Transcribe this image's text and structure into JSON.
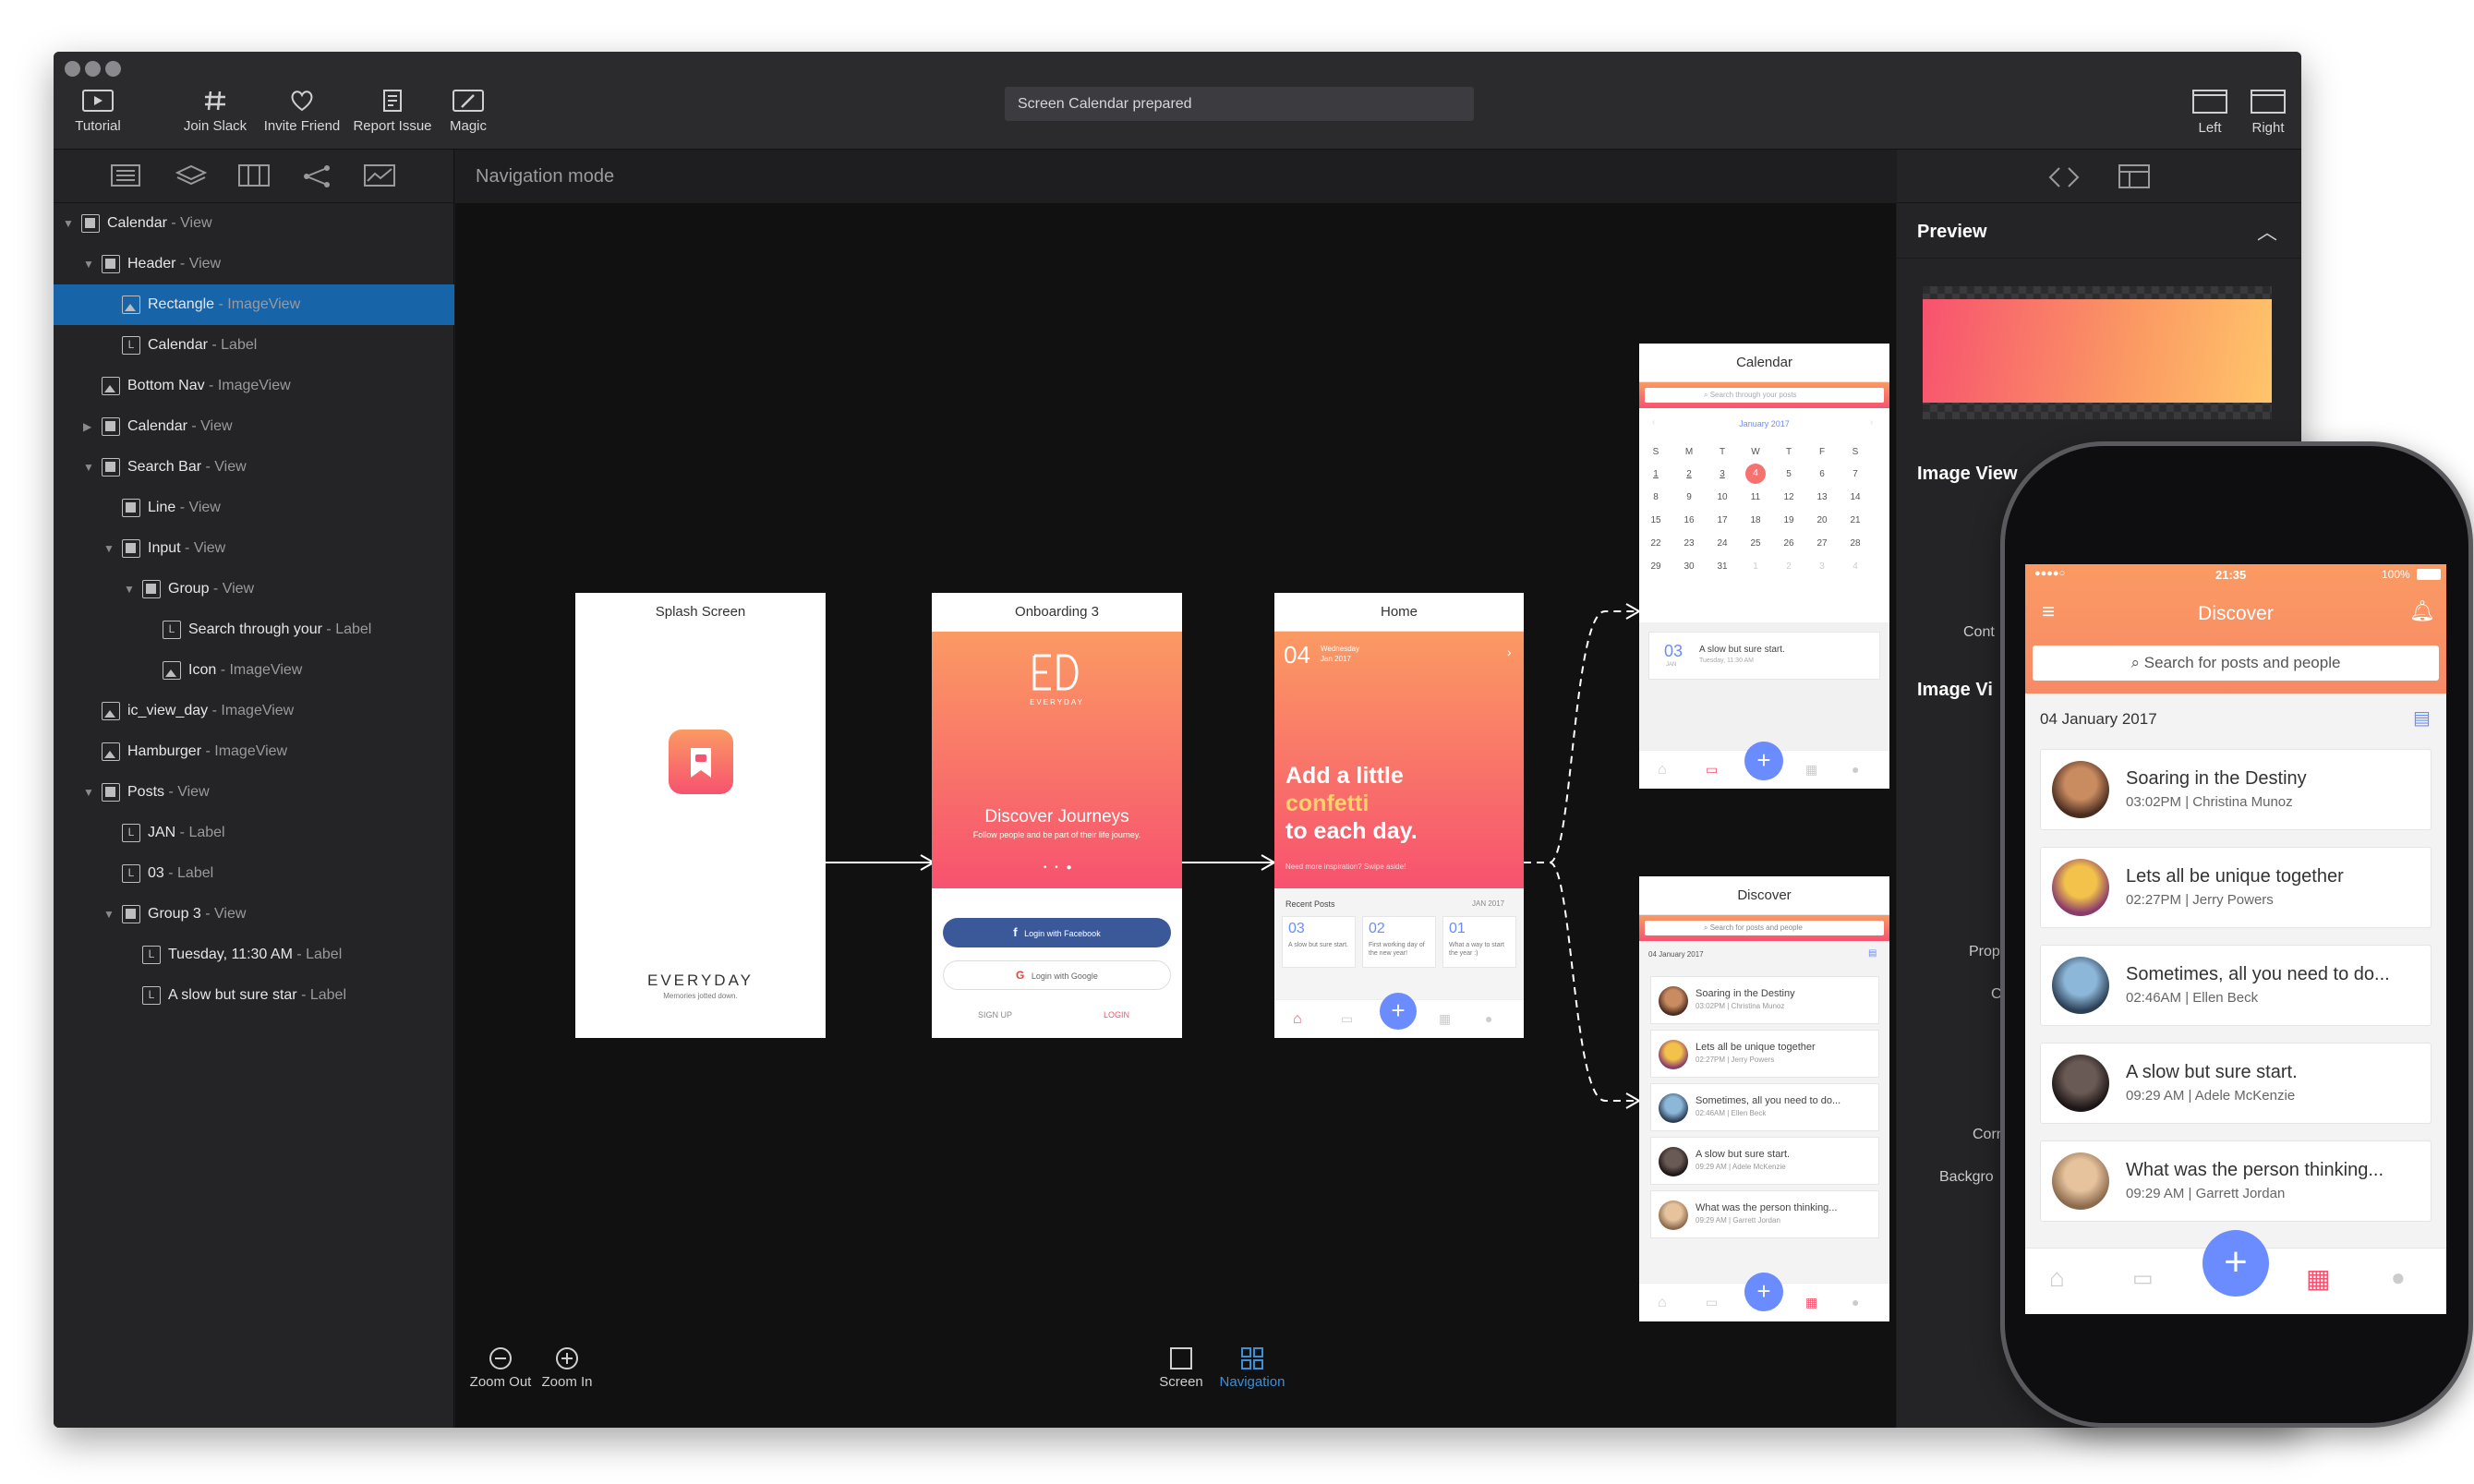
{
  "toolbar": {
    "tutorial": "Tutorial",
    "join_slack": "Join Slack",
    "invite_friend": "Invite Friend",
    "report_issue": "Report Issue",
    "magic": "Magic",
    "status": "Screen Calendar prepared",
    "left": "Left",
    "right": "Right"
  },
  "canvas": {
    "mode": "Navigation mode",
    "zoom_out": "Zoom Out",
    "zoom_in": "Zoom In",
    "screen": "Screen",
    "navigation": "Navigation"
  },
  "tree": [
    {
      "name": "Calendar",
      "kind": " - View"
    },
    {
      "name": "Header",
      "kind": " - View"
    },
    {
      "name": "Rectangle",
      "kind": " - ImageView"
    },
    {
      "name": "Calendar",
      "kind": " - Label"
    },
    {
      "name": "Bottom Nav",
      "kind": " - ImageView"
    },
    {
      "name": "Calendar",
      "kind": " - View"
    },
    {
      "name": "Search Bar",
      "kind": " - View"
    },
    {
      "name": "Line",
      "kind": " - View"
    },
    {
      "name": "Input",
      "kind": " - View"
    },
    {
      "name": "Group",
      "kind": " - View"
    },
    {
      "name": "Search through your",
      "kind": " - Label"
    },
    {
      "name": "Icon",
      "kind": " - ImageView"
    },
    {
      "name": "ic_view_day",
      "kind": " - ImageView"
    },
    {
      "name": "Hamburger",
      "kind": " - ImageView"
    },
    {
      "name": "Posts",
      "kind": " - View"
    },
    {
      "name": "JAN",
      "kind": " - Label"
    },
    {
      "name": "03",
      "kind": " - Label"
    },
    {
      "name": "Group 3",
      "kind": " - View"
    },
    {
      "name": "Tuesday, 11:30 AM",
      "kind": " - Label"
    },
    {
      "name": "A slow but sure star",
      "kind": " - Label"
    }
  ],
  "right_panel": {
    "preview": "Preview",
    "image_view": "Image View",
    "cont": "Cont",
    "image_vi": "Image Vi",
    "prope": "Prope",
    "cl": "Cl",
    "corn": "Corn",
    "backgro": "Backgro"
  },
  "splash": {
    "title": "Splash Screen",
    "brand": "EVERYDAY",
    "tagline": "Memories jotted down."
  },
  "onboarding": {
    "title": "Onboarding 3",
    "brand": "EVERYDAY",
    "heading": "Discover Journeys",
    "sub": "Follow people and be part of their life journey.",
    "facebook": "Login with Facebook",
    "google": "Login with Google",
    "signup": "SIGN UP",
    "login": "LOGIN"
  },
  "home": {
    "title": "Home",
    "day": "04",
    "weekday": "Wednesday",
    "month": "Jan 2017",
    "line1": "Add a little",
    "line2": "confetti",
    "line3": "to each day.",
    "sub": "Need more inspiration? Swipe aside!",
    "recent": "Recent Posts",
    "month_label": "JAN 2017",
    "cards": [
      {
        "day": "03",
        "text": "A slow but sure start."
      },
      {
        "day": "02",
        "text": "First working day of the new year!"
      },
      {
        "day": "01",
        "text": "What a way to start the year :)"
      }
    ]
  },
  "calendar": {
    "title": "Calendar",
    "search": "Search through your posts",
    "month": "January 2017",
    "weekdays": [
      "S",
      "M",
      "T",
      "W",
      "T",
      "F",
      "S"
    ],
    "days": [
      "1",
      "2",
      "3",
      "4",
      "5",
      "6",
      "7",
      "8",
      "9",
      "10",
      "11",
      "12",
      "13",
      "14",
      "15",
      "16",
      "17",
      "18",
      "19",
      "20",
      "21",
      "22",
      "23",
      "24",
      "25",
      "26",
      "27",
      "28",
      "29",
      "30",
      "31",
      "1",
      "2",
      "3",
      "4"
    ],
    "post_day": "03",
    "post_month": "JAN",
    "post_title": "A slow but sure start.",
    "post_time": "Tuesday, 11:30 AM"
  },
  "discover_small": {
    "title": "Discover",
    "search": "Search for posts and people",
    "date": "04 January 2017",
    "posts": [
      {
        "title": "Soaring in the Destiny",
        "sub": "03:02PM | Christina Munoz"
      },
      {
        "title": "Lets all be unique together",
        "sub": "02:27PM | Jerry Powers"
      },
      {
        "title": "Sometimes, all you need to do...",
        "sub": "02:46AM | Ellen Beck"
      },
      {
        "title": "A slow but sure start.",
        "sub": "09:29 AM | Adele McKenzie"
      },
      {
        "title": "What was the person thinking...",
        "sub": "09:29 AM | Garrett Jordan"
      }
    ]
  },
  "device": {
    "time": "21:35",
    "battery": "100%",
    "title": "Discover",
    "search": "Search for posts and people",
    "date": "04 January 2017",
    "posts": [
      {
        "title": "Soaring in the Destiny",
        "sub": "03:02PM  |  Christina Munoz"
      },
      {
        "title": "Lets all be unique together",
        "sub": "02:27PM  |  Jerry Powers"
      },
      {
        "title": "Sometimes, all you need to do...",
        "sub": "02:46AM  |  Ellen Beck"
      },
      {
        "title": "A slow but sure start.",
        "sub": "09:29 AM  |  Adele McKenzie"
      },
      {
        "title": "What was the person thinking...",
        "sub": "09:29 AM  |  Garrett Jordan"
      }
    ]
  },
  "colors": {
    "accent": "#1764a8",
    "brand_start": "#fb9a63",
    "brand_end": "#f7526f",
    "fab": "#6b8cff",
    "link": "#3d8fd6"
  }
}
